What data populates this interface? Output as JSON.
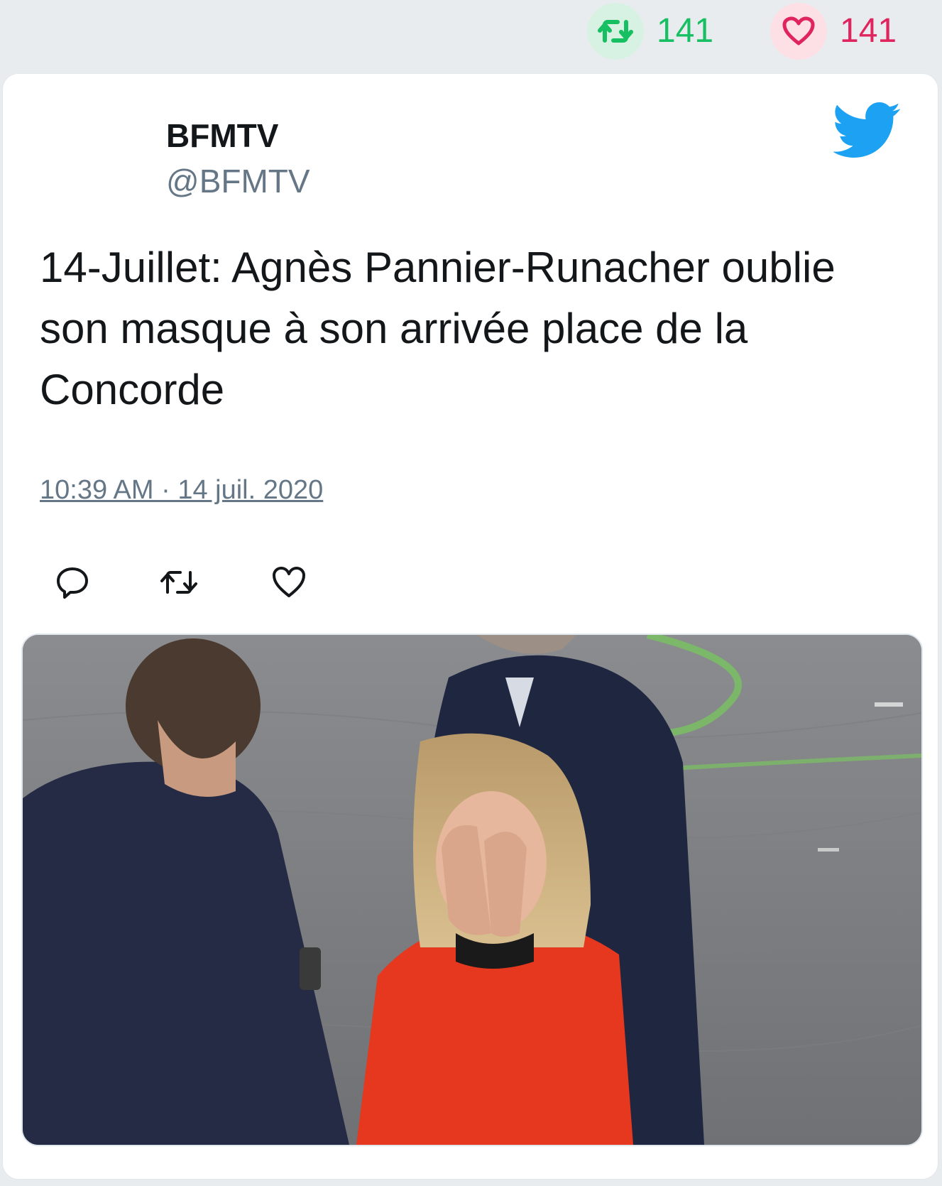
{
  "top_stats": {
    "retweets": "141",
    "likes": "141",
    "retweet_color": "#17bf63",
    "like_color": "#e0245e"
  },
  "tweet": {
    "author_name": "BFMTV",
    "author_handle": "@BFMTV",
    "text": "14-Juillet: Agnès Pannier-Runacher oublie son masque à son arrivée place de la Concorde",
    "timestamp": "10:39 AM · 14 juil. 2020",
    "brand_color": "#1da1f2"
  },
  "actions": {
    "reply_icon": "reply-icon",
    "retweet_icon": "retweet-icon",
    "like_icon": "heart-icon"
  },
  "media": {
    "type": "photo"
  }
}
